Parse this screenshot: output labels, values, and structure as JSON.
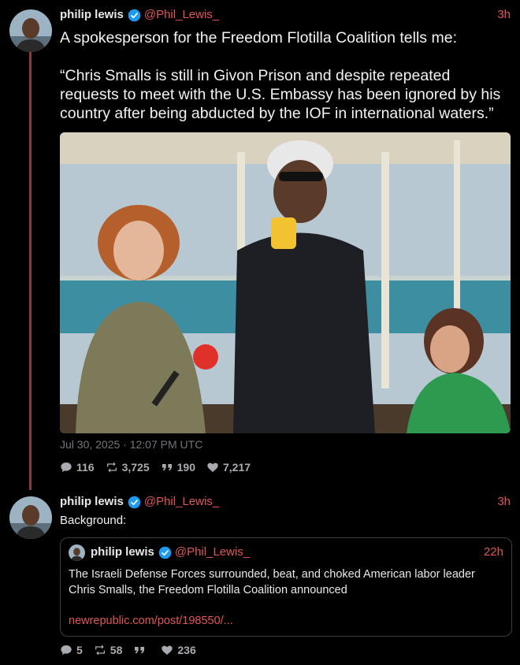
{
  "tweet1": {
    "name": "philip lewis",
    "handle": "@Phil_Lewis_",
    "time": "3h",
    "text": "A spokesperson for the Freedom Flotilla Coalition tells me:\n\n“Chris Smalls is still in Givon Prison and despite repeated requests to meet with the U.S. Embassy has been ignored by his country after being abducted by the IOF in international waters.”",
    "timestamp": "Jul 30, 2025 · 12:07 PM UTC",
    "replies": "116",
    "retweets": "3,725",
    "quotes": "190",
    "likes": "7,217"
  },
  "tweet2": {
    "name": "philip lewis",
    "handle": "@Phil_Lewis_",
    "time": "3h",
    "text": "Background:",
    "replies": "5",
    "retweets": "58",
    "quotes": "",
    "likes": "236",
    "quote": {
      "name": "philip lewis",
      "handle": "@Phil_Lewis_",
      "time": "22h",
      "text": "The Israeli Defense Forces surrounded, beat, and choked American labor leader Chris Smalls, the Freedom Flotilla Coalition announced",
      "link": "newrepublic.com/post/198550/..."
    }
  },
  "colors": {
    "accent": "#e0555a",
    "verified": "#1d9bf0",
    "thread_line": "#8a3a3a",
    "background": "#000000"
  },
  "icons": [
    "verified-badge-icon",
    "reply-icon",
    "retweet-icon",
    "quote-icon",
    "heart-icon"
  ]
}
